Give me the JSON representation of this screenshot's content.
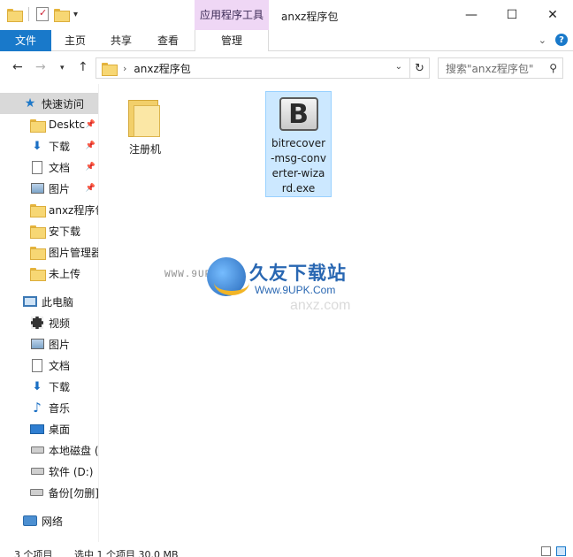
{
  "titlebar": {
    "context_tab": "应用程序工具",
    "title": "anxz程序包",
    "minimize_glyph": "—",
    "maximize_glyph": "☐",
    "close_glyph": "✕"
  },
  "ribbon": {
    "tabs": [
      "文件",
      "主页",
      "共享",
      "查看",
      "管理"
    ],
    "help_glyph": "?"
  },
  "address_bar": {
    "path": "anxz程序包",
    "search_placeholder": "搜索\"anxz程序包\""
  },
  "sidebar": {
    "items": [
      {
        "label": "快速访问",
        "icon": "star-icon"
      },
      {
        "label": "Desktc",
        "icon": "folder-icon"
      },
      {
        "label": "下载",
        "icon": "download-icon"
      },
      {
        "label": "文档",
        "icon": "document-icon"
      },
      {
        "label": "图片",
        "icon": "picture-icon"
      },
      {
        "label": "anxz程序包",
        "icon": "folder-icon"
      },
      {
        "label": "安下载",
        "icon": "folder-icon"
      },
      {
        "label": "图片管理器",
        "icon": "folder-icon"
      },
      {
        "label": "未上传",
        "icon": "folder-icon"
      },
      {
        "label": "此电脑",
        "icon": "computer-icon"
      },
      {
        "label": "视频",
        "icon": "video-icon"
      },
      {
        "label": "图片",
        "icon": "picture-icon"
      },
      {
        "label": "文档",
        "icon": "document-icon"
      },
      {
        "label": "下载",
        "icon": "download-icon"
      },
      {
        "label": "音乐",
        "icon": "music-icon"
      },
      {
        "label": "桌面",
        "icon": "desktop-icon"
      },
      {
        "label": "本地磁盘 (",
        "icon": "disk-icon"
      },
      {
        "label": "软件 (D:)",
        "icon": "disk-icon"
      },
      {
        "label": "备份[勿删]",
        "icon": "disk-icon"
      },
      {
        "label": "网络",
        "icon": "network-icon"
      }
    ]
  },
  "content": {
    "files": [
      {
        "name": "注册机",
        "type": "folder"
      },
      {
        "name": "bitrecover-msg-converter-wizard.exe",
        "lines": [
          "bitrecover",
          "-msg-conv",
          "erter-wiza",
          "rd.exe"
        ],
        "type": "exe",
        "icon_letter": "B"
      }
    ]
  },
  "watermark": {
    "title": "久友下载站",
    "url": "Www.9UPK.Com",
    "small": "WWW.9UPK.COM",
    "faint": "anxz.com"
  },
  "statusbar": {
    "count": "3 个项目",
    "selection": "选中 1 个项目  30.0 MB"
  },
  "colors": {
    "accent": "#1979ca",
    "context_tab_bg": "#efd7f5",
    "selection_bg": "#cce8ff"
  }
}
